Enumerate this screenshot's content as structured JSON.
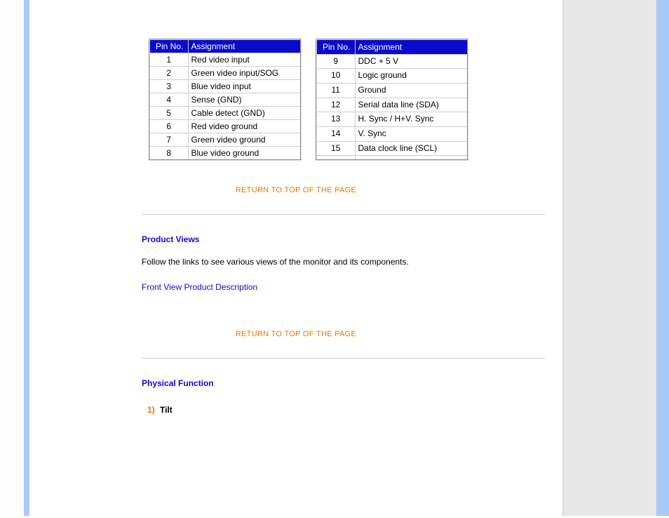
{
  "table_left": {
    "headers": {
      "pin": "Pin No.",
      "assign": "Assignment"
    },
    "rows": [
      {
        "pin": "1",
        "assign": "Red video input"
      },
      {
        "pin": "2",
        "assign": "Green video input/SOG"
      },
      {
        "pin": "3",
        "assign": "Blue video input"
      },
      {
        "pin": "4",
        "assign": "Sense (GND)"
      },
      {
        "pin": "5",
        "assign": "Cable detect (GND)"
      },
      {
        "pin": "6",
        "assign": "Red video ground"
      },
      {
        "pin": "7",
        "assign": "Green video ground"
      },
      {
        "pin": "8",
        "assign": "Blue video ground"
      }
    ]
  },
  "table_right": {
    "headers": {
      "pin": "Pin No.",
      "assign": "Assignment"
    },
    "rows": [
      {
        "pin": "9",
        "assign": "DDC + 5 V"
      },
      {
        "pin": "10",
        "assign": "Logic ground"
      },
      {
        "pin": "11",
        "assign": "Ground"
      },
      {
        "pin": "12",
        "assign": "Serial data line (SDA)"
      },
      {
        "pin": "13",
        "assign": "H. Sync / H+V. Sync"
      },
      {
        "pin": "14",
        "assign": "V. Sync"
      },
      {
        "pin": "15",
        "assign": "Data clock line (SCL)"
      },
      {
        "pin": "",
        "assign": ""
      }
    ]
  },
  "links": {
    "return_top": "RETURN TO TOP OF THE PAGE",
    "front_view": "Front View Product Description"
  },
  "sections": {
    "product_views_title": "Product Views",
    "product_views_body": "Follow the links to see various views of the monitor and its components.",
    "physical_function_title": "Physical Function",
    "tilt_num": "1)",
    "tilt_label": "Tilt"
  }
}
